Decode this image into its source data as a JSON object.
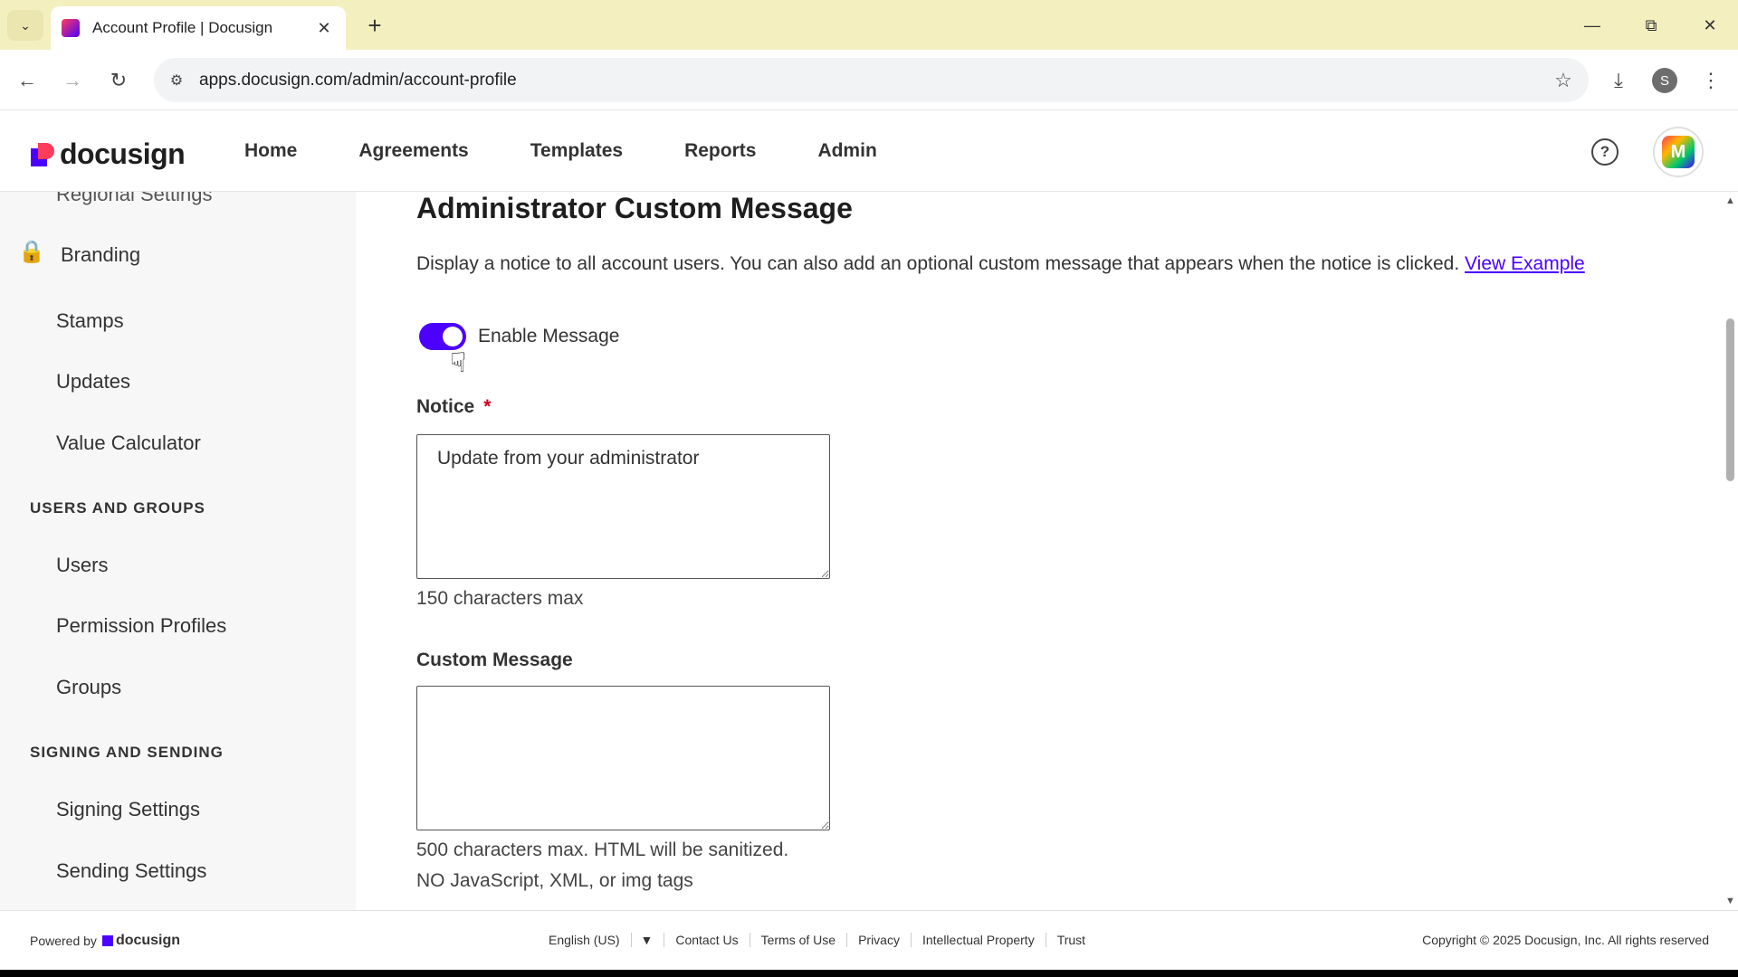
{
  "browser": {
    "tab_title": "Account Profile | Docusign",
    "url": "apps.docusign.com/admin/account-profile",
    "profile_initial": "S"
  },
  "header": {
    "logo_text": "docusign",
    "nav": [
      "Home",
      "Agreements",
      "Templates",
      "Reports",
      "Admin"
    ],
    "avatar_initial": "M"
  },
  "sidebar": {
    "cut_item": "Regional Settings",
    "branding": "Branding",
    "items_top": [
      "Stamps",
      "Updates",
      "Value Calculator"
    ],
    "section_users": "USERS AND GROUPS",
    "items_users": [
      "Users",
      "Permission Profiles",
      "Groups"
    ],
    "section_signing": "SIGNING AND SENDING",
    "items_signing": [
      "Signing Settings",
      "Sending Settings"
    ]
  },
  "main": {
    "title": "Administrator Custom Message",
    "description": "Display a notice to all account users. You can also add an optional custom message that appears when the notice is clicked.",
    "view_example": "View Example",
    "toggle_label": "Enable Message",
    "toggle_on": true,
    "notice_label": "Notice",
    "required_mark": "*",
    "notice_value": "Update from your administrator",
    "notice_hint": "150 characters max",
    "custom_label": "Custom Message",
    "custom_value": "",
    "custom_hint_1": "500 characters max. HTML will be sanitized.",
    "custom_hint_2": "NO JavaScript, XML, or img tags"
  },
  "footer": {
    "powered_by": "Powered by",
    "logo_text": "docusign",
    "language": "English (US)",
    "links": [
      "Contact Us",
      "Terms of Use",
      "Privacy",
      "Intellectual Property",
      "Trust"
    ],
    "copyright": "Copyright © 2025 Docusign, Inc. All rights reserved"
  },
  "colors": {
    "accent": "#4c00ff",
    "brand_red": "#ff3c5a",
    "tabbar": "#f4efbf"
  }
}
